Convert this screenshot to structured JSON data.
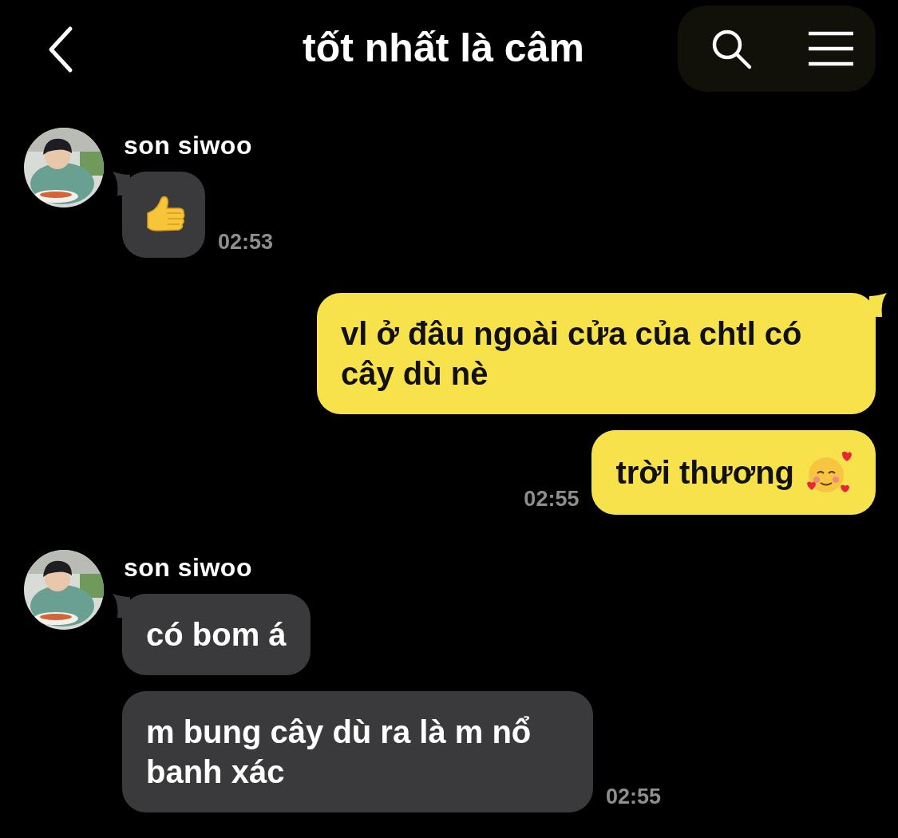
{
  "header": {
    "title": "tốt nhất là câm"
  },
  "messages": [
    {
      "kind": "received",
      "sender": "son siwoo",
      "time": "02:53",
      "bubbles": [
        {
          "kind": "sticker"
        }
      ]
    },
    {
      "kind": "sent",
      "time": "02:55",
      "bubbles": [
        {
          "kind": "text",
          "text": "vl ở đâu ngoài cửa của chtl có cây dù nè"
        },
        {
          "kind": "textemoji",
          "text": "trời thương"
        }
      ]
    },
    {
      "kind": "received",
      "sender": "son siwoo",
      "time": "02:55",
      "bubbles": [
        {
          "kind": "text",
          "text": "có bom á"
        },
        {
          "kind": "text",
          "text": "m bung cây dù ra là m nổ banh xác"
        }
      ]
    }
  ]
}
